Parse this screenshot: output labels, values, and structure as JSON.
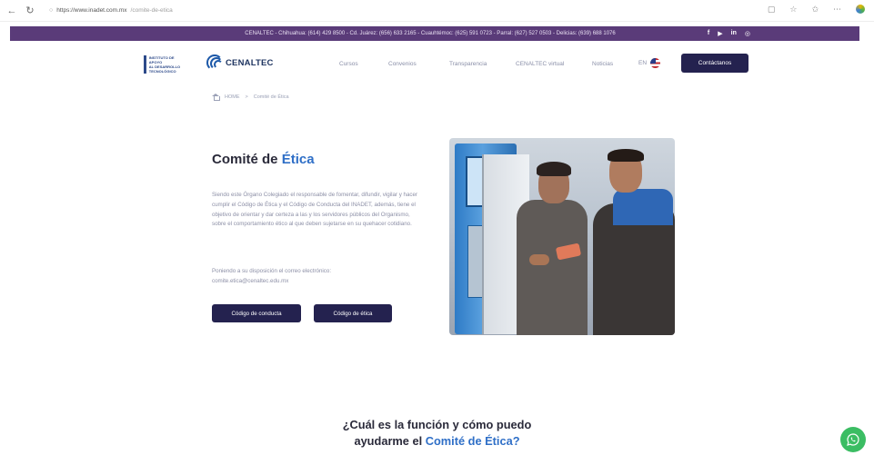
{
  "browser": {
    "url_host": "https://www.inadet.com.mx",
    "url_path": "/comite-de-etica"
  },
  "topbar": {
    "contact": "CENALTEC - Chihuahua: (614) 429 8500 - Cd. Juárez: (656) 633 2165 - Cuauhtémoc: (625) 591 0723 - Parral: (627) 527 0503 - Delicias: (639) 688 1076",
    "social": [
      "f",
      "▶",
      "in",
      "◎"
    ]
  },
  "header": {
    "gov_logo_text": [
      "INSTITUTO DE APOYO",
      "AL DESARROLLO",
      "TECNOLÓGICO"
    ],
    "logo_name": "CENALTEC",
    "menu": [
      "Cursos",
      "Convenios",
      "Transparencia",
      "CENALTEC virtual",
      "Noticias"
    ],
    "lang": "EN",
    "contact_button": "Contáctanos"
  },
  "breadcrumb": {
    "home": "HOME",
    "separator": ">",
    "current": "Comité de Ética"
  },
  "hero": {
    "title_main": "Comité de ",
    "title_accent": "Ética",
    "description": "Siendo este Órgano Colegiado el responsable de fomentar, difundir, vigilar y hacer cumplir el Código de Ética y el Código de Conducta del INADET, además, tiene el objetivo de orientar y dar certeza a las y los servidores públicos del Organismo, sobre el comportamiento ético al que deben sujetarse en su quehacer cotidiano.",
    "email_label": "Poniendo a su disposición el correo electrónico:",
    "email": "comite.etica@cenaltec.edu.mx",
    "button_conduct": "Código de conducta",
    "button_ethics": "Código de ética"
  },
  "bottom": {
    "line1": "¿Cuál es la función y cómo puedo",
    "line2_main": "ayudarme el ",
    "line2_accent": "Comité de Ética?"
  },
  "colors": {
    "topbar": "#5a3b79",
    "button": "#24224f",
    "accent": "#2f6fc7",
    "whatsapp": "#3bbd63"
  }
}
